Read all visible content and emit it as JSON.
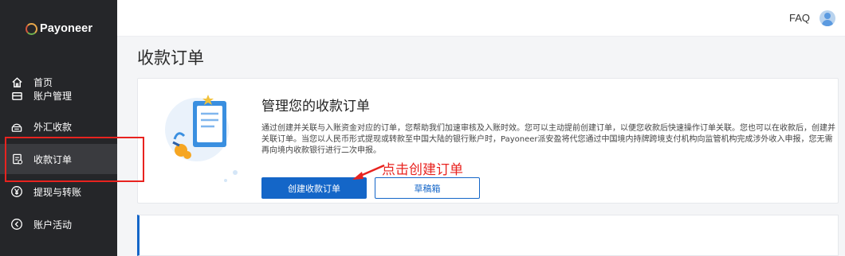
{
  "brand": {
    "name": "Payoneer"
  },
  "sidebar": {
    "items": [
      {
        "label": "首页",
        "icon": "home-icon"
      },
      {
        "label": "账户管理",
        "icon": "wallet-icon"
      },
      {
        "label": "外汇收款",
        "icon": "exchange-icon"
      },
      {
        "label": "收款订单",
        "icon": "order-icon",
        "active": true
      },
      {
        "label": "提现与转账",
        "icon": "yen-icon"
      },
      {
        "label": "账户活动",
        "icon": "activity-icon"
      }
    ]
  },
  "header": {
    "faq": "FAQ",
    "avatar": "user-avatar-icon"
  },
  "main": {
    "title": "收款订单",
    "card": {
      "title": "管理您的收款订单",
      "description": "通过创建并关联与入账资金对应的订单，您帮助我们加速审核及入账时效。您可以主动提前创建订单，以便您收款后快速操作订单关联。您也可以在收款后，创建并关联订单。当您以人民币形式提现或转款至中国大陆的银行账户时，Payoneer派安盈将代您通过中国境内持牌跨境支付机构向监管机构完成涉外收入申报，您无需再向境内收款银行进行二次申报。",
      "primary_button": "创建收款订单",
      "secondary_button": "草稿箱"
    }
  },
  "annotation": {
    "text": "点击创建订单",
    "color": "#e8231f"
  },
  "colors": {
    "sidebar_bg": "#252629",
    "accent": "#1466c8",
    "annotation": "#e8231f"
  }
}
